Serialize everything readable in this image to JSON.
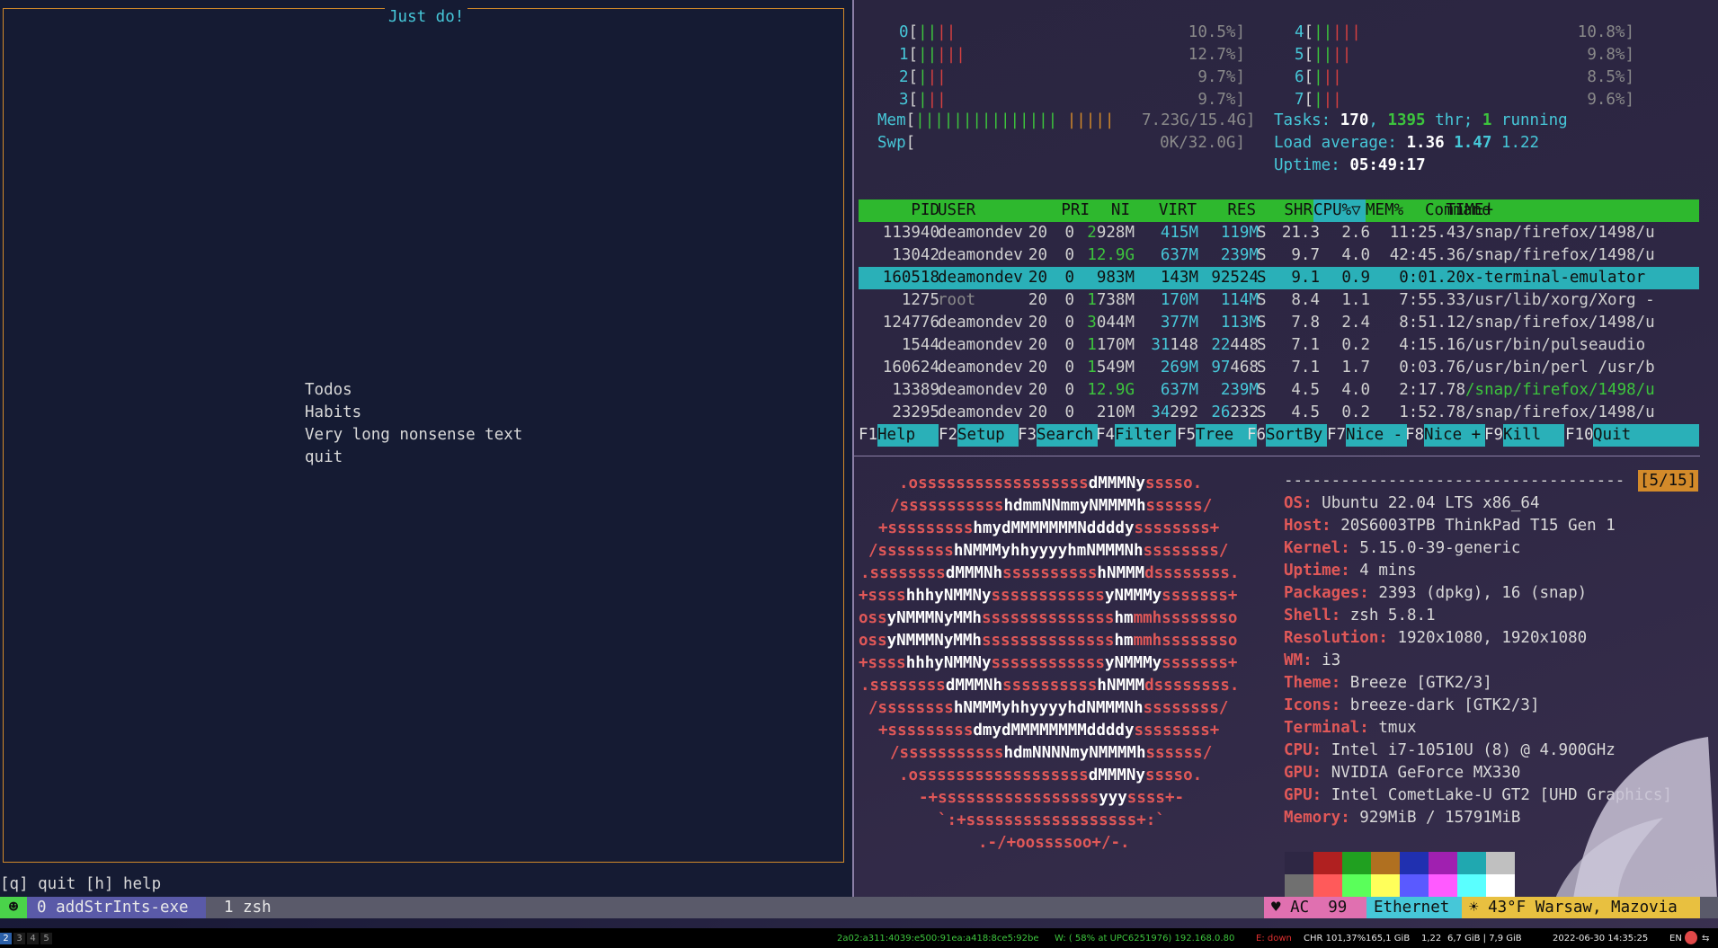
{
  "left": {
    "app_title": "Just do!",
    "menu": [
      "Todos",
      "Habits",
      "Very long nonsense text",
      "quit"
    ],
    "help": "[q] quit [h] help"
  },
  "htop": {
    "cpus_left": [
      {
        "id": "0",
        "bars": [
          "||",
          "||"
        ],
        "pct": "10.5%]"
      },
      {
        "id": "1",
        "bars": [
          "||",
          "|||"
        ],
        "pct": "12.7%]"
      },
      {
        "id": "2",
        "bars": [
          "|",
          "||"
        ],
        "pct": "9.7%]"
      },
      {
        "id": "3",
        "bars": [
          "|",
          "||"
        ],
        "pct": "9.7%]"
      }
    ],
    "cpus_right": [
      {
        "id": "4",
        "bars": [
          "||",
          "|||"
        ],
        "pct": "10.8%]"
      },
      {
        "id": "5",
        "bars": [
          "||",
          "||"
        ],
        "pct": "9.8%]"
      },
      {
        "id": "6",
        "bars": [
          "|",
          "||"
        ],
        "pct": "8.5%]"
      },
      {
        "id": "7",
        "bars": [
          "|",
          "||"
        ],
        "pct": "9.6%]"
      }
    ],
    "mem_label": "Mem",
    "mem_bar_green": "||||||||||||||| ",
    "mem_bar_orange": "|||||",
    "mem_value": "7.23G/15.4G]",
    "swp_label": "Swp",
    "swp_value": "0K/32.0G]",
    "tasks_label": "Tasks:",
    "tasks": "170",
    "threads": "1395",
    "thr_label": "thr;",
    "running": "1",
    "running_label": "running",
    "load_label": "Load average:",
    "load1": "1.36",
    "load5": "1.47",
    "load15": "1.22",
    "uptime_label": "Uptime:",
    "uptime": "05:49:17",
    "columns": [
      "PID",
      "USER",
      "PRI",
      "NI",
      "VIRT",
      "RES",
      "SHR",
      "S",
      "CPU%▽",
      "MEM%",
      "TIME+",
      "Command"
    ],
    "processes": [
      {
        "pid": "113940",
        "user": "deamondev",
        "pri": "20",
        "ni": "0",
        "virt_a": "2",
        "virt_b": "928M",
        "res": "415M",
        "shr": "119M",
        "s": "S",
        "cpu": "21.3",
        "mem": "2.6",
        "time": "11:25.43",
        "cmd": "/snap/firefox/1498/u"
      },
      {
        "pid": "13042",
        "user": "deamondev",
        "pri": "20",
        "ni": "0",
        "virt_a": "12.9G",
        "virt_b": "",
        "res": "637M",
        "shr": "239M",
        "s": "S",
        "cpu": "9.7",
        "mem": "4.0",
        "time": "42:45.36",
        "cmd": "/snap/firefox/1498/u"
      },
      {
        "pid": "160518",
        "user": "deamondev",
        "pri": "20",
        "ni": "0",
        "virt_a": "",
        "virt_b": "983M",
        "res": "143M",
        "shr": "92524",
        "s": "S",
        "cpu": "9.1",
        "mem": "0.9",
        "time": "0:01.20",
        "cmd": "x-terminal-emulator"
      },
      {
        "pid": "1275",
        "user": "root",
        "pri": "20",
        "ni": "0",
        "virt_a": "1",
        "virt_b": "738M",
        "res": "170M",
        "shr": "114M",
        "s": "S",
        "cpu": "8.4",
        "mem": "1.1",
        "time": "7:55.33",
        "cmd": "/usr/lib/xorg/Xorg -"
      },
      {
        "pid": "124776",
        "user": "deamondev",
        "pri": "20",
        "ni": "0",
        "virt_a": "3",
        "virt_b": "044M",
        "res": "377M",
        "shr": "113M",
        "s": "S",
        "cpu": "7.8",
        "mem": "2.4",
        "time": "8:51.12",
        "cmd": "/snap/firefox/1498/u"
      },
      {
        "pid": "1544",
        "user": "deamondev",
        "pri": "20",
        "ni": "0",
        "virt_a": "1",
        "virt_b": "170M",
        "res_a": "31",
        "res": "148",
        "shr_a": "22",
        "shr": "448",
        "s": "S",
        "cpu": "7.1",
        "mem": "0.2",
        "time": "4:15.16",
        "cmd": "/usr/bin/pulseaudio"
      },
      {
        "pid": "160624",
        "user": "deamondev",
        "pri": "20",
        "ni": "0",
        "virt_a": "1",
        "virt_b": "549M",
        "res": "269M",
        "shr_a": "97",
        "shr": "468",
        "s": "S",
        "cpu": "7.1",
        "mem": "1.7",
        "time": "0:03.76",
        "cmd": "/usr/bin/perl /usr/b"
      },
      {
        "pid": "13389",
        "user": "deamondev",
        "pri": "20",
        "ni": "0",
        "virt_a": "12.9G",
        "virt_b": "",
        "res": "637M",
        "shr": "239M",
        "s": "S",
        "cpu": "4.5",
        "mem": "4.0",
        "time": "2:17.78",
        "cmd": "/snap/firefox/1498/u"
      },
      {
        "pid": "23295",
        "user": "deamondev",
        "pri": "20",
        "ni": "0",
        "virt_a": "",
        "virt_b": "210M",
        "res_a": "34",
        "res": "292",
        "shr_a": "26",
        "shr": "232",
        "s": "S",
        "cpu": "4.5",
        "mem": "0.2",
        "time": "1:52.78",
        "cmd": "/snap/firefox/1498/u"
      }
    ],
    "fkeys": [
      {
        "key": "F1",
        "label": "Help  "
      },
      {
        "key": "F2",
        "label": "Setup "
      },
      {
        "key": "F3",
        "label": "Search"
      },
      {
        "key": "F4",
        "label": "Filter"
      },
      {
        "key": "F5",
        "label": "Tree  "
      },
      {
        "key": "F6",
        "label": "SortBy"
      },
      {
        "key": "F7",
        "label": "Nice -"
      },
      {
        "key": "F8",
        "label": "Nice +"
      },
      {
        "key": "F9",
        "label": "Kill  "
      },
      {
        "key": "F10",
        "label": "Quit      "
      }
    ]
  },
  "neofetch": {
    "separator": "------------------------------------",
    "page": "[5/15]",
    "logo": [
      ".ossssssssssssssssssdMMMNysssso.",
      "/ssssssssssshdmmNNmmyNMMMMhssssss/",
      "+ssssssssshmydMMMMMMMNddddyssssssss+",
      "/sssssssshNMMMyhhyyyyhmNMMMNhssssssss/",
      ".ssssssssdMMMNhsssssssssshNMMMdssssssss.",
      "+sssshhhyNMMNyssssssssssssyNMMMysssssss+",
      "ossyNMMMNyMMhsssssssssssssshmmmhssssssso",
      "ossyNMMMNyMMhsssssssssssssshmmmhssssssso",
      "+sssshhhyNMMNyssssssssssssyNMMMysssssss+",
      ".ssssssssdMMMNhsssssssssshNMMMdssssssss.",
      "/sssssssshNMMMyhhyyyyhdNMMMNhssssssss/",
      "+sssssssssdmydMMMMMMMMddddyssssssss+",
      "/ssssssssssshdmNNNNmyNMMMMhssssss/",
      ".ossssssssssssssssssdMMMNysssso.",
      "-+sssssssssssssssssyyyssss+-",
      "`:+ssssssssssssssssss+:`",
      ".-/+oossssoo+/-."
    ],
    "info": [
      {
        "key": "OS",
        "value": "Ubuntu 22.04 LTS x86_64"
      },
      {
        "key": "Host",
        "value": "20S6003TPB ThinkPad T15 Gen 1"
      },
      {
        "key": "Kernel",
        "value": "5.15.0-39-generic"
      },
      {
        "key": "Uptime",
        "value": "4 mins"
      },
      {
        "key": "Packages",
        "value": "2393 (dpkg), 16 (snap)"
      },
      {
        "key": "Shell",
        "value": "zsh 5.8.1"
      },
      {
        "key": "Resolution",
        "value": "1920x1080, 1920x1080"
      },
      {
        "key": "WM",
        "value": "i3"
      },
      {
        "key": "Theme",
        "value": "Breeze [GTK2/3]"
      },
      {
        "key": "Icons",
        "value": "breeze-dark [GTK2/3]"
      },
      {
        "key": "Terminal",
        "value": "tmux"
      },
      {
        "key": "CPU",
        "value": "Intel i7-10510U (8) @ 4.900GHz"
      },
      {
        "key": "GPU",
        "value": "NVIDIA GeForce MX330"
      },
      {
        "key": "GPU",
        "value": "Intel CometLake-U GT2 [UHD Graphics]"
      },
      {
        "key": "Memory",
        "value": "929MiB / 15791MiB"
      }
    ],
    "palette_top": [
      "#2e2744",
      "#b02020",
      "#20a020",
      "#b07020",
      "#2030b0",
      "#a020b0",
      "#20a8b0",
      "#c0c0c0"
    ],
    "palette_bottom": [
      "#707070",
      "#ff5a5a",
      "#5aff5a",
      "#ffff5a",
      "#5a5aff",
      "#ff5aff",
      "#5affff",
      "#ffffff"
    ]
  },
  "tmux": {
    "session_icon": "☻",
    "window0": "0 addStrInts-exe",
    "window1": "1 zsh",
    "battery": "♥ AC  99",
    "network": "Ethernet",
    "weather": "☀ 43°F Warsaw, Mazovia"
  },
  "i3bar": {
    "workspaces": [
      "2",
      "3",
      "4",
      "5"
    ],
    "ipv6": "2a02:a311:4039:e500:91ea:a418:8ce5:92be",
    "wifi": "W: ( 58% at UPC6251976) 192.168.0.80",
    "eth": "E: down",
    "battery": "CHR 101,37%",
    "disk": "165,1 GiB",
    "load": "1,22",
    "mem": "6,7 GiB | 7,9 GiB",
    "datetime": "2022-06-30 14:35:25",
    "lang": "EN"
  }
}
